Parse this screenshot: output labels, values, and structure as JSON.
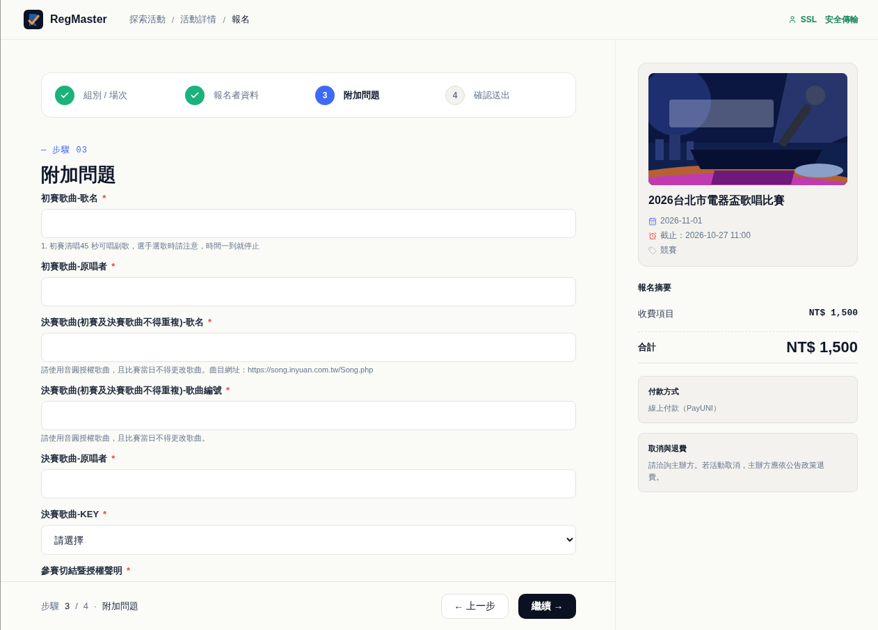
{
  "header": {
    "brand": "RegMaster",
    "breadcrumbs": [
      {
        "label": "探索活動",
        "current": false
      },
      {
        "label": "活動詳情",
        "current": false
      },
      {
        "label": "報名",
        "current": true
      }
    ],
    "breadcrumb_separator": "/",
    "secure": {
      "label": "SSL",
      "text": "安全傳輸"
    }
  },
  "steps": [
    {
      "label": "組別 / 場次",
      "done": true,
      "selected": false
    },
    {
      "label": "報名者資料",
      "done": true,
      "selected": false
    },
    {
      "label": "附加問題",
      "done": false,
      "selected": true,
      "number": "3"
    },
    {
      "label": "確認送出",
      "done": false,
      "selected": false,
      "number": "4"
    }
  ],
  "section": {
    "eyebrow": "— 步驟 03",
    "title": "附加問題"
  },
  "fields": [
    {
      "kind": "text",
      "label": "初賽歌曲-歌名",
      "mark": "*",
      "hint": "1. 初賽清唱45 秒可唱副歌，選手選歌時請注意，時間一到就停止"
    },
    {
      "kind": "text",
      "label": "初賽歌曲-原唱者",
      "mark": "*"
    },
    {
      "kind": "text",
      "label": "決賽歌曲(初賽及決賽歌曲不得重複)-歌名",
      "mark": "*",
      "hint": "請使用音圓授權歌曲，且比賽當日不得更改歌曲。曲目網址：https://song.inyuan.com.tw/Song.php"
    },
    {
      "kind": "text",
      "label": "決賽歌曲(初賽及決賽歌曲不得重複)-歌曲編號",
      "mark": "*",
      "hint": "請使用音圓授權歌曲，且比賽當日不得更改歌曲。"
    },
    {
      "kind": "text",
      "label": "決賽歌曲-原唱者",
      "mark": "*"
    },
    {
      "kind": "select",
      "label": "決賽歌曲-KEY",
      "mark": "*",
      "value": "請選擇"
    },
    {
      "kind": "cut",
      "label": "參賽切結暨授權聲明",
      "mark": "*"
    }
  ],
  "footer": {
    "progress": {
      "word": "步驟",
      "current": "3",
      "separator": "/",
      "total": "4",
      "dot": "·",
      "name": "附加問題"
    },
    "back_button": "← 上一步",
    "next_button": "繼續 →"
  },
  "event": {
    "title": "2026台北市電器盃歌唱比賽",
    "meta": [
      {
        "kind": "date",
        "text": "2026-11-01"
      },
      {
        "kind": "deadline",
        "text": "截止：2026-10-27 11:00"
      },
      {
        "kind": "category",
        "text": "競賽"
      }
    ]
  },
  "summary": {
    "title": "報名摘要",
    "fee": {
      "label": "收費項目",
      "amount": "NT$ 1,500"
    },
    "total": {
      "label": "合計",
      "amount": "NT$ 1,500"
    }
  },
  "info_boxes": [
    {
      "title": "付款方式",
      "text": "線上付款（PayUNI）"
    },
    {
      "title": "取消與退費",
      "text": "請洽詢主辦方。若活動取消，主辦方應依公告政策退費。"
    }
  ]
}
